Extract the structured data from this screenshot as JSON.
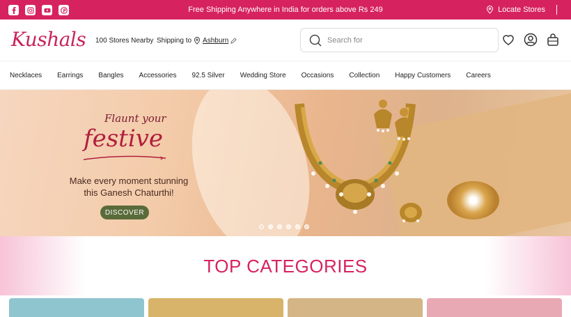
{
  "topbar": {
    "promo": "Free Shipping Anywhere in India for orders above Rs 249",
    "locate": "Locate Stores",
    "social_icons": [
      "facebook-icon",
      "instagram-icon",
      "youtube-icon",
      "pinterest-icon"
    ],
    "color": "#d6235f"
  },
  "header": {
    "logo": "Kushals",
    "nearby": "100 Stores Nearby",
    "shipping_label": "Shipping to",
    "shipping_city": "Ashburn",
    "search_placeholder": "Search for"
  },
  "nav": {
    "items": [
      "Necklaces",
      "Earrings",
      "Bangles",
      "Accessories",
      "92.5 Silver",
      "Wedding Store",
      "Occasions",
      "Collection",
      "Happy Customers",
      "Careers"
    ]
  },
  "banner": {
    "line1": "Flaunt your",
    "line2": "festive",
    "tagline_1": "Make every moment stunning",
    "tagline_2": "this Ganesh Chaturthi!",
    "cta": "DISCOVER",
    "slide_count": 6,
    "active_slide": 0
  },
  "categories": {
    "title": "TOP CATEGORIES",
    "tile_colors": [
      "#8fc5cf",
      "#d8b36a",
      "#d4b585",
      "#e8a8b4"
    ]
  }
}
